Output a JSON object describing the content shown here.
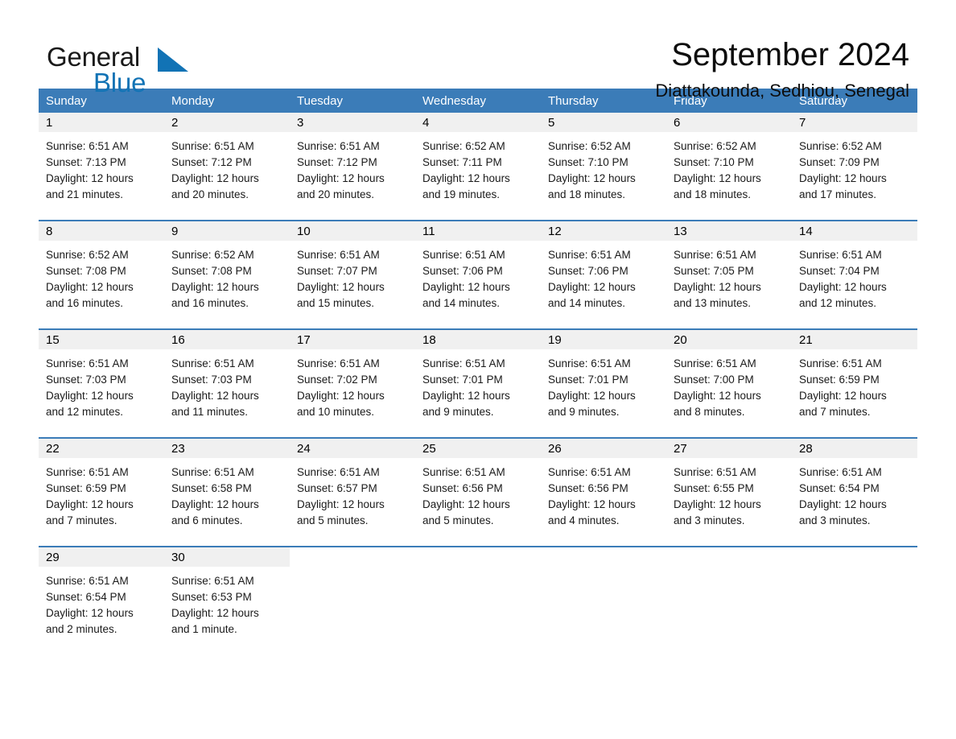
{
  "logo": {
    "text_top": "General",
    "text_bottom": "Blue",
    "triangle_color": "#1273b5"
  },
  "header": {
    "title": "September 2024",
    "subtitle": "Diattakounda, Sedhiou, Senegal"
  },
  "colors": {
    "header_blue": "#3b7cb8",
    "daynum_band": "#f0f0f0",
    "text": "#1a1a1a"
  },
  "weekdays": [
    "Sunday",
    "Monday",
    "Tuesday",
    "Wednesday",
    "Thursday",
    "Friday",
    "Saturday"
  ],
  "weeks": [
    [
      {
        "day": "1",
        "sunrise": "Sunrise: 6:51 AM",
        "sunset": "Sunset: 7:13 PM",
        "daylight1": "Daylight: 12 hours",
        "daylight2": "and 21 minutes."
      },
      {
        "day": "2",
        "sunrise": "Sunrise: 6:51 AM",
        "sunset": "Sunset: 7:12 PM",
        "daylight1": "Daylight: 12 hours",
        "daylight2": "and 20 minutes."
      },
      {
        "day": "3",
        "sunrise": "Sunrise: 6:51 AM",
        "sunset": "Sunset: 7:12 PM",
        "daylight1": "Daylight: 12 hours",
        "daylight2": "and 20 minutes."
      },
      {
        "day": "4",
        "sunrise": "Sunrise: 6:52 AM",
        "sunset": "Sunset: 7:11 PM",
        "daylight1": "Daylight: 12 hours",
        "daylight2": "and 19 minutes."
      },
      {
        "day": "5",
        "sunrise": "Sunrise: 6:52 AM",
        "sunset": "Sunset: 7:10 PM",
        "daylight1": "Daylight: 12 hours",
        "daylight2": "and 18 minutes."
      },
      {
        "day": "6",
        "sunrise": "Sunrise: 6:52 AM",
        "sunset": "Sunset: 7:10 PM",
        "daylight1": "Daylight: 12 hours",
        "daylight2": "and 18 minutes."
      },
      {
        "day": "7",
        "sunrise": "Sunrise: 6:52 AM",
        "sunset": "Sunset: 7:09 PM",
        "daylight1": "Daylight: 12 hours",
        "daylight2": "and 17 minutes."
      }
    ],
    [
      {
        "day": "8",
        "sunrise": "Sunrise: 6:52 AM",
        "sunset": "Sunset: 7:08 PM",
        "daylight1": "Daylight: 12 hours",
        "daylight2": "and 16 minutes."
      },
      {
        "day": "9",
        "sunrise": "Sunrise: 6:52 AM",
        "sunset": "Sunset: 7:08 PM",
        "daylight1": "Daylight: 12 hours",
        "daylight2": "and 16 minutes."
      },
      {
        "day": "10",
        "sunrise": "Sunrise: 6:51 AM",
        "sunset": "Sunset: 7:07 PM",
        "daylight1": "Daylight: 12 hours",
        "daylight2": "and 15 minutes."
      },
      {
        "day": "11",
        "sunrise": "Sunrise: 6:51 AM",
        "sunset": "Sunset: 7:06 PM",
        "daylight1": "Daylight: 12 hours",
        "daylight2": "and 14 minutes."
      },
      {
        "day": "12",
        "sunrise": "Sunrise: 6:51 AM",
        "sunset": "Sunset: 7:06 PM",
        "daylight1": "Daylight: 12 hours",
        "daylight2": "and 14 minutes."
      },
      {
        "day": "13",
        "sunrise": "Sunrise: 6:51 AM",
        "sunset": "Sunset: 7:05 PM",
        "daylight1": "Daylight: 12 hours",
        "daylight2": "and 13 minutes."
      },
      {
        "day": "14",
        "sunrise": "Sunrise: 6:51 AM",
        "sunset": "Sunset: 7:04 PM",
        "daylight1": "Daylight: 12 hours",
        "daylight2": "and 12 minutes."
      }
    ],
    [
      {
        "day": "15",
        "sunrise": "Sunrise: 6:51 AM",
        "sunset": "Sunset: 7:03 PM",
        "daylight1": "Daylight: 12 hours",
        "daylight2": "and 12 minutes."
      },
      {
        "day": "16",
        "sunrise": "Sunrise: 6:51 AM",
        "sunset": "Sunset: 7:03 PM",
        "daylight1": "Daylight: 12 hours",
        "daylight2": "and 11 minutes."
      },
      {
        "day": "17",
        "sunrise": "Sunrise: 6:51 AM",
        "sunset": "Sunset: 7:02 PM",
        "daylight1": "Daylight: 12 hours",
        "daylight2": "and 10 minutes."
      },
      {
        "day": "18",
        "sunrise": "Sunrise: 6:51 AM",
        "sunset": "Sunset: 7:01 PM",
        "daylight1": "Daylight: 12 hours",
        "daylight2": "and 9 minutes."
      },
      {
        "day": "19",
        "sunrise": "Sunrise: 6:51 AM",
        "sunset": "Sunset: 7:01 PM",
        "daylight1": "Daylight: 12 hours",
        "daylight2": "and 9 minutes."
      },
      {
        "day": "20",
        "sunrise": "Sunrise: 6:51 AM",
        "sunset": "Sunset: 7:00 PM",
        "daylight1": "Daylight: 12 hours",
        "daylight2": "and 8 minutes."
      },
      {
        "day": "21",
        "sunrise": "Sunrise: 6:51 AM",
        "sunset": "Sunset: 6:59 PM",
        "daylight1": "Daylight: 12 hours",
        "daylight2": "and 7 minutes."
      }
    ],
    [
      {
        "day": "22",
        "sunrise": "Sunrise: 6:51 AM",
        "sunset": "Sunset: 6:59 PM",
        "daylight1": "Daylight: 12 hours",
        "daylight2": "and 7 minutes."
      },
      {
        "day": "23",
        "sunrise": "Sunrise: 6:51 AM",
        "sunset": "Sunset: 6:58 PM",
        "daylight1": "Daylight: 12 hours",
        "daylight2": "and 6 minutes."
      },
      {
        "day": "24",
        "sunrise": "Sunrise: 6:51 AM",
        "sunset": "Sunset: 6:57 PM",
        "daylight1": "Daylight: 12 hours",
        "daylight2": "and 5 minutes."
      },
      {
        "day": "25",
        "sunrise": "Sunrise: 6:51 AM",
        "sunset": "Sunset: 6:56 PM",
        "daylight1": "Daylight: 12 hours",
        "daylight2": "and 5 minutes."
      },
      {
        "day": "26",
        "sunrise": "Sunrise: 6:51 AM",
        "sunset": "Sunset: 6:56 PM",
        "daylight1": "Daylight: 12 hours",
        "daylight2": "and 4 minutes."
      },
      {
        "day": "27",
        "sunrise": "Sunrise: 6:51 AM",
        "sunset": "Sunset: 6:55 PM",
        "daylight1": "Daylight: 12 hours",
        "daylight2": "and 3 minutes."
      },
      {
        "day": "28",
        "sunrise": "Sunrise: 6:51 AM",
        "sunset": "Sunset: 6:54 PM",
        "daylight1": "Daylight: 12 hours",
        "daylight2": "and 3 minutes."
      }
    ],
    [
      {
        "day": "29",
        "sunrise": "Sunrise: 6:51 AM",
        "sunset": "Sunset: 6:54 PM",
        "daylight1": "Daylight: 12 hours",
        "daylight2": "and 2 minutes."
      },
      {
        "day": "30",
        "sunrise": "Sunrise: 6:51 AM",
        "sunset": "Sunset: 6:53 PM",
        "daylight1": "Daylight: 12 hours",
        "daylight2": "and 1 minute."
      },
      {
        "day": "",
        "sunrise": "",
        "sunset": "",
        "daylight1": "",
        "daylight2": ""
      },
      {
        "day": "",
        "sunrise": "",
        "sunset": "",
        "daylight1": "",
        "daylight2": ""
      },
      {
        "day": "",
        "sunrise": "",
        "sunset": "",
        "daylight1": "",
        "daylight2": ""
      },
      {
        "day": "",
        "sunrise": "",
        "sunset": "",
        "daylight1": "",
        "daylight2": ""
      },
      {
        "day": "",
        "sunrise": "",
        "sunset": "",
        "daylight1": "",
        "daylight2": ""
      }
    ]
  ]
}
